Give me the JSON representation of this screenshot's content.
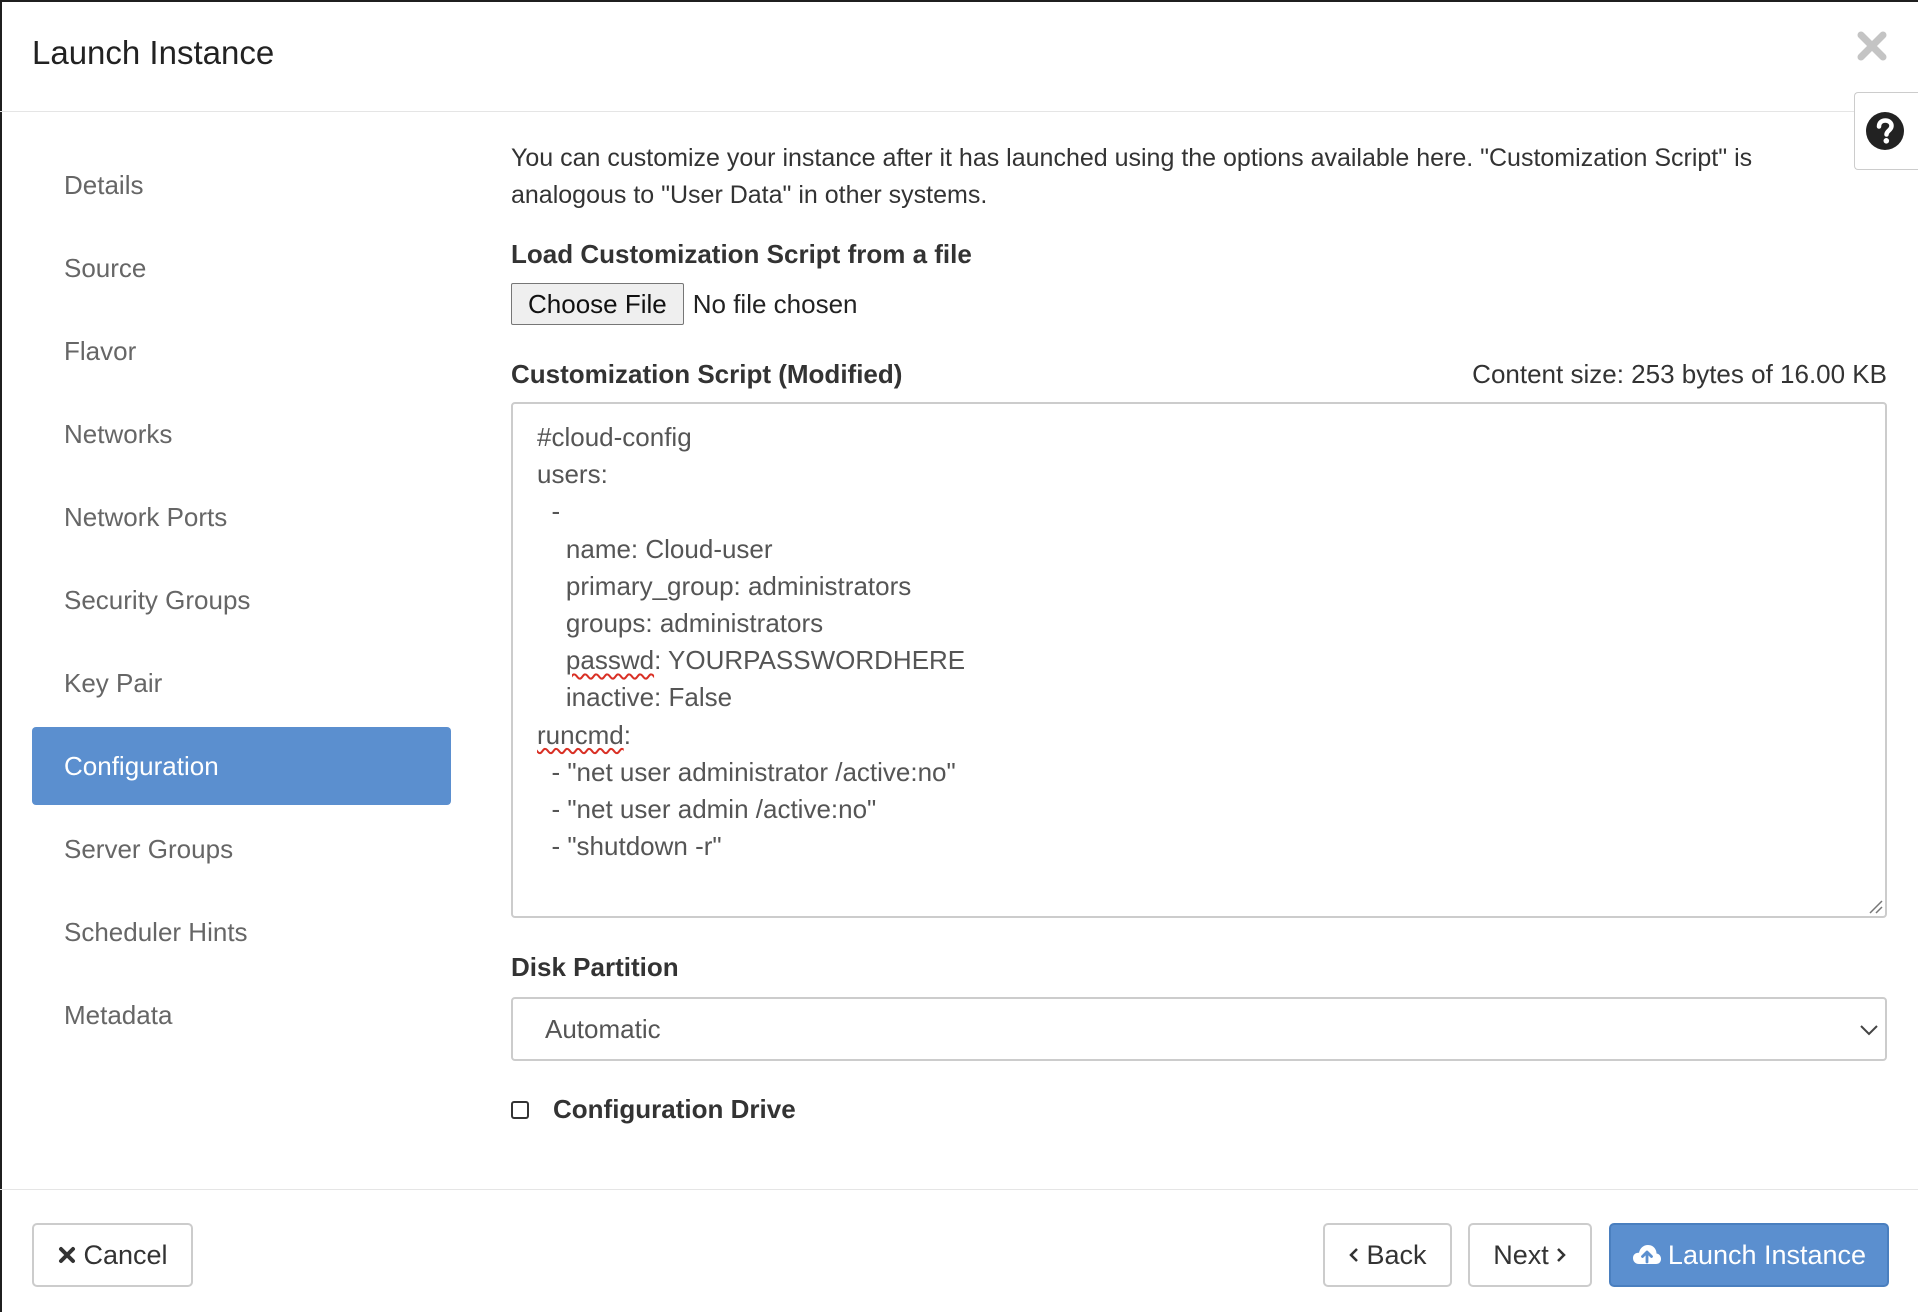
{
  "dialog": {
    "title": "Launch Instance"
  },
  "nav": {
    "items": [
      {
        "label": "Details"
      },
      {
        "label": "Source"
      },
      {
        "label": "Flavor"
      },
      {
        "label": "Networks"
      },
      {
        "label": "Network Ports"
      },
      {
        "label": "Security Groups"
      },
      {
        "label": "Key Pair"
      },
      {
        "label": "Configuration",
        "active": true
      },
      {
        "label": "Server Groups"
      },
      {
        "label": "Scheduler Hints"
      },
      {
        "label": "Metadata"
      }
    ]
  },
  "configuration": {
    "intro_line1": "You can customize your instance after it has launched using the options available here. \"Customization Script\" is",
    "intro_line2": "analogous to \"User Data\" in other systems.",
    "load_label": "Load Customization Script from a file",
    "choose_file_label": "Choose File",
    "no_file_text": "No file chosen",
    "script_label": "Customization Script (Modified)",
    "content_size": "Content size: 253 bytes of 16.00 KB",
    "script": {
      "line1": "#cloud-config",
      "line2": "users:",
      "line3": "  -",
      "line4": "    name: Cloud-user",
      "line5": "    primary_group: administrators",
      "line6": "    groups: administrators",
      "line7_word": "passwd",
      "line7_rest": ": YOURPASSWORDHERE",
      "line8": "    inactive: False",
      "line9_word": "runcmd",
      "line9_rest": ":",
      "line10": "  - \"net user administrator /active:no\"",
      "line11": "  - \"net user admin /active:no\"",
      "line12": "  - \"shutdown -r\""
    },
    "disk_partition_label": "Disk Partition",
    "disk_partition_value": "Automatic",
    "config_drive_label": "Configuration Drive",
    "config_drive_checked": false
  },
  "footer": {
    "cancel_label": "Cancel",
    "back_label": "Back",
    "next_label": "Next",
    "launch_label": "Launch Instance"
  },
  "colors": {
    "accent": "#5b8fcf",
    "nav_text": "#666666",
    "border": "#cccccc"
  }
}
